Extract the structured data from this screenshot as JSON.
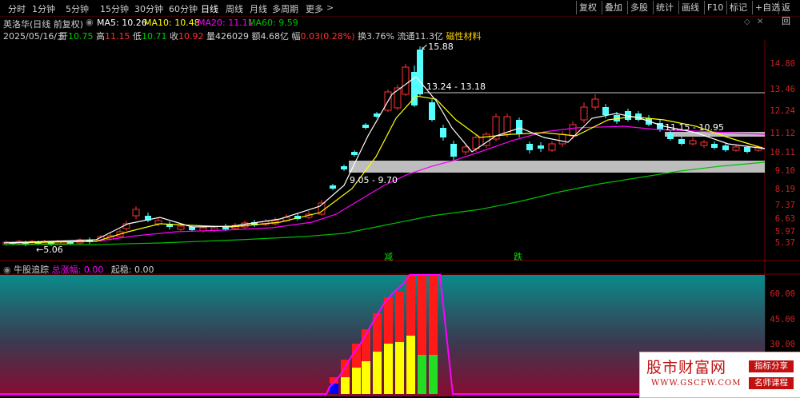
{
  "toolbar": {
    "left": [
      "分时",
      "1分钟",
      "5分钟",
      "15分钟",
      "30分钟",
      "60分钟",
      "日线",
      "周线",
      "月线",
      "多周期",
      "更多"
    ],
    "active": "日线",
    "right": [
      "复权",
      "叠加",
      "多股",
      "统计",
      "画线",
      "F10",
      "标记",
      "+自选",
      "返回"
    ]
  },
  "header": {
    "stock": "英洛华(日线 前复权)",
    "ma5_label": "MA5: 10.26",
    "ma10_label": "MA10: 10.48",
    "ma20_label": "MA20: 11.11",
    "ma60_label": "MA60: 9.59",
    "date": "2025/05/16/五",
    "open_label": "开",
    "open": "10.75",
    "high_label": "高",
    "high": "11.15",
    "low_label": "低",
    "low": "10.71",
    "close_label": "收",
    "close": "10.92",
    "vol_label": "量",
    "vol": "426029",
    "amt_label": "额",
    "amt": "4.68亿",
    "chg_label": "幅",
    "chg": "0.03(0.28%)",
    "turnover": "换3.76%",
    "float": "流通11.3亿",
    "sector": "磁性材料"
  },
  "annotations": {
    "peak": "15.88",
    "band_upper": "13.24 - 13.18",
    "band_mid": "11.15 - 10.95",
    "band_lower": "9.05 - 9.70",
    "low_start": "5.06",
    "signal_jian": "减",
    "signal_die": "跌"
  },
  "price_axis": [
    "14.80",
    "13.46",
    "12.24",
    "11.12",
    "10.11",
    "9.10",
    "8.19",
    "7.37",
    "6.63",
    "5.97",
    "5.37"
  ],
  "indicator": {
    "name": "牛股追踪",
    "total_label": "总涨幅:",
    "total_value": "0.00",
    "start_label": "起稳:",
    "start_value": "0.00",
    "axis": [
      "60.00",
      "45.00",
      "30.00"
    ]
  },
  "colors": {
    "up": "#ff3232",
    "down": "#54ffff",
    "ma5": "#ffffff",
    "ma10": "#ffff00",
    "ma20": "#ff00ff",
    "ma60": "#00c000",
    "axis_text": "#cc2222"
  },
  "watermark": {
    "title": "股市财富网",
    "url": "WWW.GSCFW.COM",
    "tag1": "指标分享",
    "tag2": "名师课程"
  }
}
